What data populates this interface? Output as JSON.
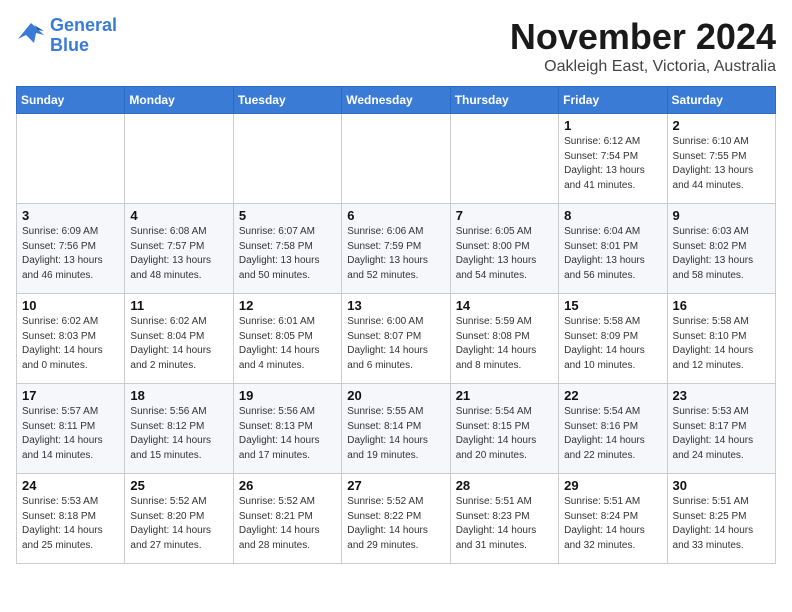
{
  "header": {
    "logo_line1": "General",
    "logo_line2": "Blue",
    "month": "November 2024",
    "location": "Oakleigh East, Victoria, Australia"
  },
  "days_of_week": [
    "Sunday",
    "Monday",
    "Tuesday",
    "Wednesday",
    "Thursday",
    "Friday",
    "Saturday"
  ],
  "weeks": [
    [
      {
        "day": "",
        "info": ""
      },
      {
        "day": "",
        "info": ""
      },
      {
        "day": "",
        "info": ""
      },
      {
        "day": "",
        "info": ""
      },
      {
        "day": "",
        "info": ""
      },
      {
        "day": "1",
        "info": "Sunrise: 6:12 AM\nSunset: 7:54 PM\nDaylight: 13 hours\nand 41 minutes."
      },
      {
        "day": "2",
        "info": "Sunrise: 6:10 AM\nSunset: 7:55 PM\nDaylight: 13 hours\nand 44 minutes."
      }
    ],
    [
      {
        "day": "3",
        "info": "Sunrise: 6:09 AM\nSunset: 7:56 PM\nDaylight: 13 hours\nand 46 minutes."
      },
      {
        "day": "4",
        "info": "Sunrise: 6:08 AM\nSunset: 7:57 PM\nDaylight: 13 hours\nand 48 minutes."
      },
      {
        "day": "5",
        "info": "Sunrise: 6:07 AM\nSunset: 7:58 PM\nDaylight: 13 hours\nand 50 minutes."
      },
      {
        "day": "6",
        "info": "Sunrise: 6:06 AM\nSunset: 7:59 PM\nDaylight: 13 hours\nand 52 minutes."
      },
      {
        "day": "7",
        "info": "Sunrise: 6:05 AM\nSunset: 8:00 PM\nDaylight: 13 hours\nand 54 minutes."
      },
      {
        "day": "8",
        "info": "Sunrise: 6:04 AM\nSunset: 8:01 PM\nDaylight: 13 hours\nand 56 minutes."
      },
      {
        "day": "9",
        "info": "Sunrise: 6:03 AM\nSunset: 8:02 PM\nDaylight: 13 hours\nand 58 minutes."
      }
    ],
    [
      {
        "day": "10",
        "info": "Sunrise: 6:02 AM\nSunset: 8:03 PM\nDaylight: 14 hours\nand 0 minutes."
      },
      {
        "day": "11",
        "info": "Sunrise: 6:02 AM\nSunset: 8:04 PM\nDaylight: 14 hours\nand 2 minutes."
      },
      {
        "day": "12",
        "info": "Sunrise: 6:01 AM\nSunset: 8:05 PM\nDaylight: 14 hours\nand 4 minutes."
      },
      {
        "day": "13",
        "info": "Sunrise: 6:00 AM\nSunset: 8:07 PM\nDaylight: 14 hours\nand 6 minutes."
      },
      {
        "day": "14",
        "info": "Sunrise: 5:59 AM\nSunset: 8:08 PM\nDaylight: 14 hours\nand 8 minutes."
      },
      {
        "day": "15",
        "info": "Sunrise: 5:58 AM\nSunset: 8:09 PM\nDaylight: 14 hours\nand 10 minutes."
      },
      {
        "day": "16",
        "info": "Sunrise: 5:58 AM\nSunset: 8:10 PM\nDaylight: 14 hours\nand 12 minutes."
      }
    ],
    [
      {
        "day": "17",
        "info": "Sunrise: 5:57 AM\nSunset: 8:11 PM\nDaylight: 14 hours\nand 14 minutes."
      },
      {
        "day": "18",
        "info": "Sunrise: 5:56 AM\nSunset: 8:12 PM\nDaylight: 14 hours\nand 15 minutes."
      },
      {
        "day": "19",
        "info": "Sunrise: 5:56 AM\nSunset: 8:13 PM\nDaylight: 14 hours\nand 17 minutes."
      },
      {
        "day": "20",
        "info": "Sunrise: 5:55 AM\nSunset: 8:14 PM\nDaylight: 14 hours\nand 19 minutes."
      },
      {
        "day": "21",
        "info": "Sunrise: 5:54 AM\nSunset: 8:15 PM\nDaylight: 14 hours\nand 20 minutes."
      },
      {
        "day": "22",
        "info": "Sunrise: 5:54 AM\nSunset: 8:16 PM\nDaylight: 14 hours\nand 22 minutes."
      },
      {
        "day": "23",
        "info": "Sunrise: 5:53 AM\nSunset: 8:17 PM\nDaylight: 14 hours\nand 24 minutes."
      }
    ],
    [
      {
        "day": "24",
        "info": "Sunrise: 5:53 AM\nSunset: 8:18 PM\nDaylight: 14 hours\nand 25 minutes."
      },
      {
        "day": "25",
        "info": "Sunrise: 5:52 AM\nSunset: 8:20 PM\nDaylight: 14 hours\nand 27 minutes."
      },
      {
        "day": "26",
        "info": "Sunrise: 5:52 AM\nSunset: 8:21 PM\nDaylight: 14 hours\nand 28 minutes."
      },
      {
        "day": "27",
        "info": "Sunrise: 5:52 AM\nSunset: 8:22 PM\nDaylight: 14 hours\nand 29 minutes."
      },
      {
        "day": "28",
        "info": "Sunrise: 5:51 AM\nSunset: 8:23 PM\nDaylight: 14 hours\nand 31 minutes."
      },
      {
        "day": "29",
        "info": "Sunrise: 5:51 AM\nSunset: 8:24 PM\nDaylight: 14 hours\nand 32 minutes."
      },
      {
        "day": "30",
        "info": "Sunrise: 5:51 AM\nSunset: 8:25 PM\nDaylight: 14 hours\nand 33 minutes."
      }
    ]
  ]
}
